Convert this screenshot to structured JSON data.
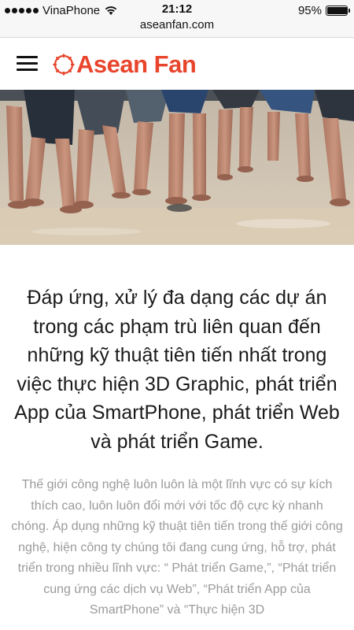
{
  "status_bar": {
    "carrier": "VinaPhone",
    "time": "21:12",
    "battery_text": "95%",
    "battery_level": 0.95,
    "url": "aseanfan.com"
  },
  "header": {
    "menu_icon": "hamburger-menu-icon",
    "logo_text": "Asean Fan",
    "logo_color": "#e8452c"
  },
  "hero": {
    "image": "beach-people-legs-photo"
  },
  "content": {
    "headline": "Đáp ứng, xử lý đa dạng các dự án trong các phạm trù liên quan đến những kỹ thuật tiên tiến nhất trong việc thực hiện 3D Graphic, phát triển App của SmartPhone, phát triển Web và phát triển Game.",
    "body": "Thế giới công nghệ luôn luôn là một lĩnh vực có sự kích thích cao, luôn luôn đổi mới với tốc độ cực kỳ nhanh chóng. Áp dụng những kỹ thuật tiên tiến trong thế giới công nghệ, hiện công ty chúng tôi đang cung ứng, hỗ trợ, phát triển trong nhiều lĩnh vực: “ Phát triển Game,”, “Phát triển cung ứng các dịch vụ Web”, “Phát triển App của SmartPhone” và “Thực hiện 3D"
  }
}
